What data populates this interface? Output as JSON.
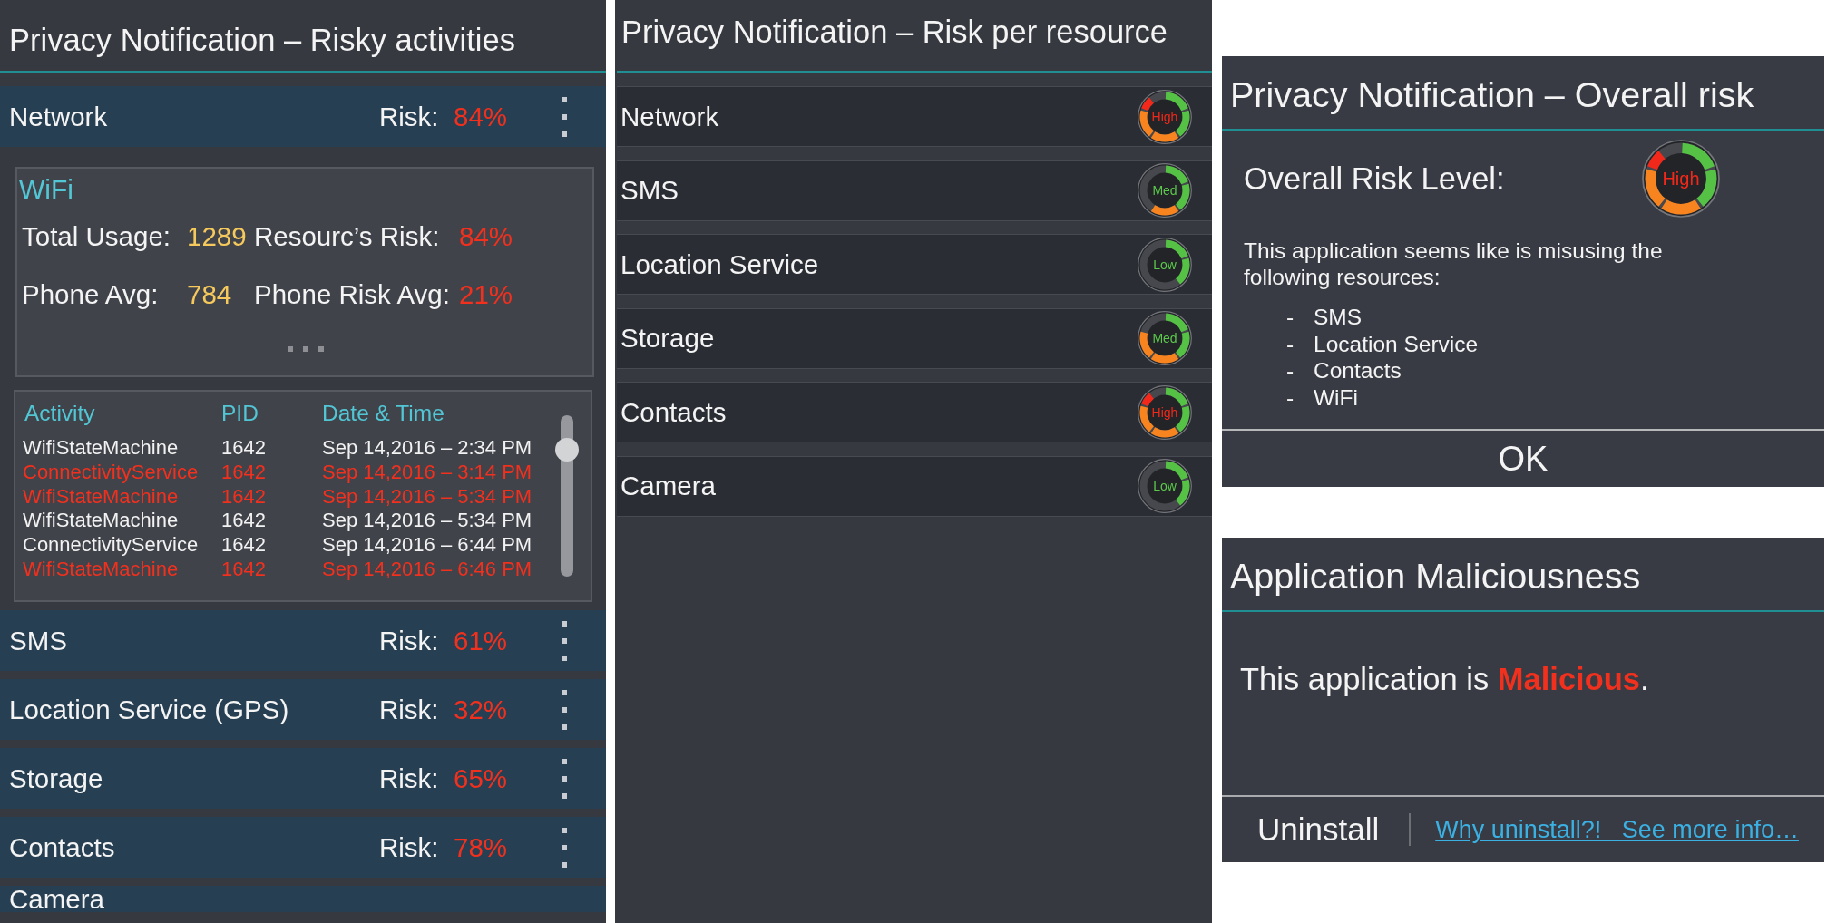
{
  "risky_activities": {
    "title": "Privacy Notification – Risky activities",
    "resources": [
      {
        "name": "Network",
        "risk_label": "Risk:",
        "risk": "84%",
        "details": {
          "title": "WiFi",
          "stats": [
            {
              "label": "Total Usage:",
              "value": "1289",
              "kind": "count"
            },
            {
              "label": "Resourc’s Risk:",
              "value": "84%",
              "kind": "risk"
            },
            {
              "label": "Phone Avg:",
              "value": "784",
              "kind": "count"
            },
            {
              "label": "Phone Risk Avg:",
              "value": "21%",
              "kind": "risk"
            }
          ],
          "activity_table": {
            "columns": [
              "Activity",
              "PID",
              "Date & Time"
            ],
            "rows": [
              {
                "cells": [
                  "WifiStateMachine",
                  "1642",
                  "Sep 14,2016 – 2:34 PM"
                ],
                "flagged": false
              },
              {
                "cells": [
                  "ConnectivityService",
                  "1642",
                  "Sep 14,2016 – 3:14 PM"
                ],
                "flagged": true
              },
              {
                "cells": [
                  "WifiStateMachine",
                  "1642",
                  "Sep 14,2016 – 5:34 PM"
                ],
                "flagged": true
              },
              {
                "cells": [
                  "WifiStateMachine",
                  "1642",
                  "Sep 14,2016 – 5:34 PM"
                ],
                "flagged": false
              },
              {
                "cells": [
                  "ConnectivityService",
                  "1642",
                  "Sep 14,2016 – 6:44 PM"
                ],
                "flagged": false
              },
              {
                "cells": [
                  "WifiStateMachine",
                  "1642",
                  "Sep 14,2016 – 6:46 PM"
                ],
                "flagged": true
              }
            ]
          }
        }
      },
      {
        "name": "SMS",
        "risk_label": "Risk:",
        "risk": "61%"
      },
      {
        "name": "Location Service (GPS)",
        "risk_label": "Risk:",
        "risk": "32%"
      },
      {
        "name": "Storage",
        "risk_label": "Risk:",
        "risk": "65%"
      },
      {
        "name": "Contacts",
        "risk_label": "Risk:",
        "risk": "78%"
      },
      {
        "name": "Camera"
      }
    ]
  },
  "risk_per_resource": {
    "title": "Privacy Notification – Risk per resource",
    "resources": [
      {
        "name": "Network",
        "rating": {
          "text": "High",
          "color": "#f2281a"
        },
        "segments": [
          {
            "color": "#55c246"
          },
          {
            "color": "#55c246"
          },
          {
            "color": "#f7841f"
          },
          {
            "color": "#f7841f"
          },
          {
            "color": "#f2281a"
          }
        ]
      },
      {
        "name": "SMS",
        "rating": {
          "text": "Med",
          "color": "#5cc84c"
        },
        "segments": [
          {
            "color": "#55c246"
          },
          {
            "color": "#55c246"
          },
          {
            "color": "#f7841f"
          }
        ]
      },
      {
        "name": "Location Service",
        "rating": {
          "text": "Low",
          "color": "#5cc84c"
        },
        "segments": [
          {
            "color": "#55c246"
          },
          {
            "color": "#55c246"
          }
        ]
      },
      {
        "name": "Storage",
        "rating": {
          "text": "Med",
          "color": "#5cc84c"
        },
        "segments": [
          {
            "color": "#55c246"
          },
          {
            "color": "#55c246"
          },
          {
            "color": "#f7841f"
          },
          {
            "color": "#f7841f"
          }
        ]
      },
      {
        "name": "Contacts",
        "rating": {
          "text": "High",
          "color": "#f2281a"
        },
        "segments": [
          {
            "color": "#55c246"
          },
          {
            "color": "#55c246"
          },
          {
            "color": "#f7841f"
          },
          {
            "color": "#f7841f"
          },
          {
            "color": "#f2281a"
          }
        ]
      },
      {
        "name": "Camera",
        "rating": {
          "text": "Low",
          "color": "#5cc84c"
        },
        "segments": [
          {
            "color": "#55c246"
          },
          {
            "color": "#55c246"
          }
        ]
      }
    ]
  },
  "overall_risk_dialog": {
    "title": "Privacy Notification – Overall risk",
    "label": "Overall Risk Level:",
    "rating": {
      "text": "High",
      "color": "#f2281a"
    },
    "segments": [
      {
        "color": "#55c246"
      },
      {
        "color": "#55c246"
      },
      {
        "color": "#f7841f"
      },
      {
        "color": "#f7841f"
      },
      {
        "color": "#f2281a"
      }
    ],
    "message": "This application seems like is misusing the following resources:",
    "items": [
      {
        "marker": "-",
        "text": "SMS"
      },
      {
        "marker": "-",
        "text": "Location Service"
      },
      {
        "marker": "-",
        "text": "Contacts"
      },
      {
        "marker": "-",
        "text": "WiFi"
      }
    ],
    "ok_button": "OK"
  },
  "maliciousness_dialog": {
    "title": "Application Maliciousness",
    "message": "This application is **Malicious**.",
    "uninstall_button": "Uninstall",
    "link": "Why uninstall?!   See more info…"
  }
}
